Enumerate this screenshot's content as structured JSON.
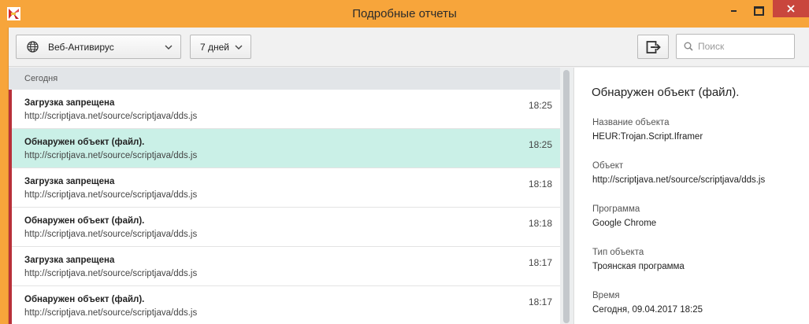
{
  "window": {
    "title": "Подробные отчеты"
  },
  "toolbar": {
    "component_filter": "Веб-Антивирус",
    "period_filter": "7 дней",
    "search_placeholder": "Поиск"
  },
  "list": {
    "group_label": "Сегодня",
    "rows": [
      {
        "title": "Загрузка запрещена",
        "url": "http://scriptjava.net/source/scriptjava/dds.js",
        "time": "18:25",
        "selected": false
      },
      {
        "title": "Обнаружен объект (файл).",
        "url": "http://scriptjava.net/source/scriptjava/dds.js",
        "time": "18:25",
        "selected": true
      },
      {
        "title": "Загрузка запрещена",
        "url": "http://scriptjava.net/source/scriptjava/dds.js",
        "time": "18:18",
        "selected": false
      },
      {
        "title": "Обнаружен объект (файл).",
        "url": "http://scriptjava.net/source/scriptjava/dds.js",
        "time": "18:18",
        "selected": false
      },
      {
        "title": "Загрузка запрещена",
        "url": "http://scriptjava.net/source/scriptjava/dds.js",
        "time": "18:17",
        "selected": false
      },
      {
        "title": "Обнаружен объект (файл).",
        "url": "http://scriptjava.net/source/scriptjava/dds.js",
        "time": "18:17",
        "selected": false
      }
    ]
  },
  "detail": {
    "heading": "Обнаружен объект (файл).",
    "fields": [
      {
        "label": "Название объекта",
        "value": "HEUR:Trojan.Script.Iframer"
      },
      {
        "label": "Объект",
        "value": "http://scriptjava.net/source/scriptjava/dds.js"
      },
      {
        "label": "Программа",
        "value": "Google Chrome"
      },
      {
        "label": "Тип объекта",
        "value": "Троянская программа"
      },
      {
        "label": "Время",
        "value": "Сегодня, 09.04.2017 18:25"
      }
    ]
  },
  "colors": {
    "window_frame": "#f7a53b",
    "close_button": "#c9463d",
    "severity_marker": "#b8303a",
    "selected_row": "#caf0e7"
  },
  "icons": {
    "app": "kaspersky-logo-icon",
    "component": "globe-icon",
    "export": "export-icon",
    "search": "search-icon"
  }
}
